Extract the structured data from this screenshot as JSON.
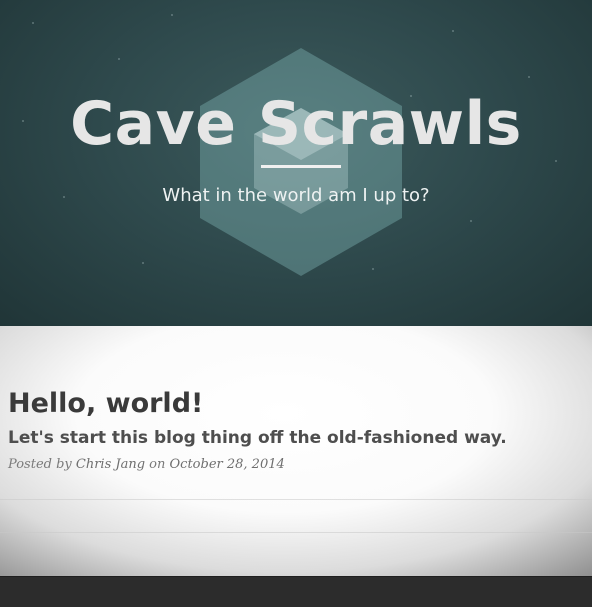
{
  "site": {
    "title": "Cave Scrawls",
    "tagline": "What in the world am I up to?"
  },
  "post": {
    "title": "Hello, world!",
    "subtitle": "Let's start this blog thing off the old-fashioned way.",
    "meta_prefix": "Posted by ",
    "author": "Chris Jang",
    "meta_on": " on ",
    "date": "October 28, 2014"
  },
  "colors": {
    "hero_bg": "#2f4a4d",
    "hex_fill": "#7fb3b3",
    "title_text": "#e6e6e6",
    "post_title": "#3a3a3a",
    "footer_bg": "#2c2c2c"
  },
  "icons": {
    "logo": "hexagon-logo-icon"
  }
}
